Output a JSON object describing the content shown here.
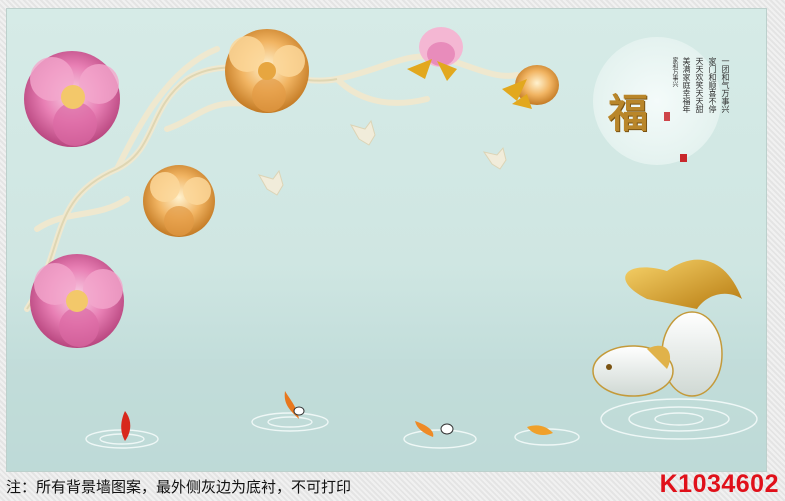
{
  "mural": {
    "poem_lines": [
      "一团和气万事兴",
      "家门和顺喜不停",
      "天天欢笑天天甜",
      "美满家庭幸福年"
    ],
    "poem_signature": "家和万事兴",
    "character": "福"
  },
  "footer": {
    "note": "注：所有背景墙图案，最外侧灰边为底衬，不可打印",
    "code": "K1034602"
  },
  "colors": {
    "background": "#d6ebe7",
    "peony_pink": "#e87fb4",
    "peony_gold": "#f1b462",
    "code_red": "#e0101a"
  }
}
